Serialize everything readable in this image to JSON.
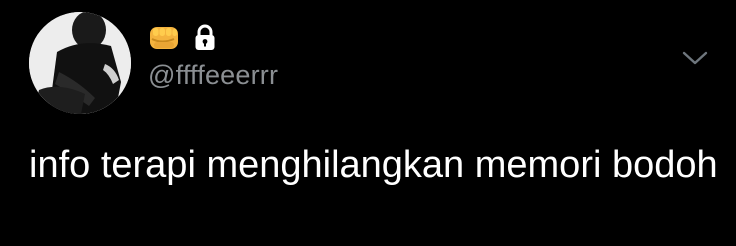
{
  "tweet": {
    "handle": "@ffffeeerrr",
    "name_badges": [
      "fist-emoji",
      "lock-icon"
    ],
    "text": "info terapi menghilangkan memori bodoh"
  },
  "colors": {
    "background": "#000000",
    "text_primary": "#ffffff",
    "text_secondary": "#8b8f93",
    "chevron": "#6e767d"
  },
  "icons": {
    "menu": "chevron-down-icon",
    "profile": "avatar"
  }
}
